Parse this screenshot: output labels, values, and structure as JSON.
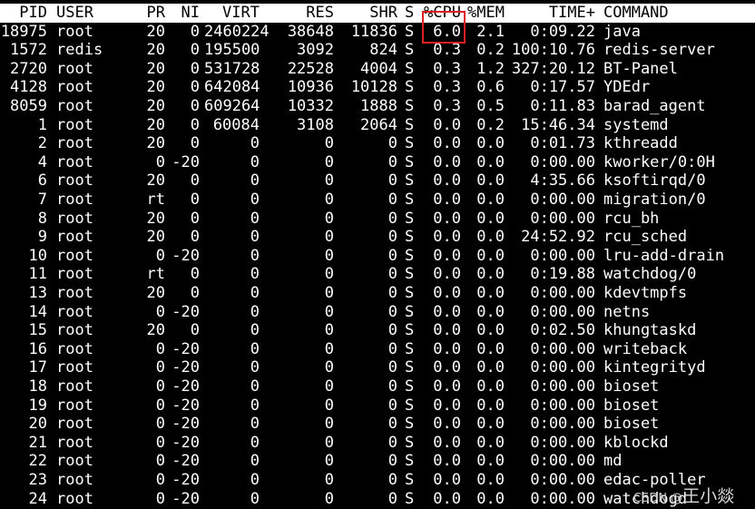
{
  "columns": {
    "pid": "PID",
    "user": "USER",
    "pr": "PR",
    "ni": "NI",
    "virt": "VIRT",
    "res": "RES",
    "shr": "SHR",
    "s": "S",
    "cpu": "%CPU",
    "mem": "%MEM",
    "time": "TIME+",
    "command": "COMMAND"
  },
  "processes": [
    {
      "pid": "18975",
      "user": "root",
      "pr": "20",
      "ni": "0",
      "virt": "2460224",
      "res": "38648",
      "shr": "11836",
      "s": "S",
      "cpu": "6.0",
      "mem": "2.1",
      "time": "0:09.22",
      "command": "java"
    },
    {
      "pid": "1572",
      "user": "redis",
      "pr": "20",
      "ni": "0",
      "virt": "195500",
      "res": "3092",
      "shr": "824",
      "s": "S",
      "cpu": "0.3",
      "mem": "0.2",
      "time": "100:10.76",
      "command": "redis-server"
    },
    {
      "pid": "2720",
      "user": "root",
      "pr": "20",
      "ni": "0",
      "virt": "531728",
      "res": "22528",
      "shr": "4004",
      "s": "S",
      "cpu": "0.3",
      "mem": "1.2",
      "time": "327:20.12",
      "command": "BT-Panel"
    },
    {
      "pid": "4128",
      "user": "root",
      "pr": "20",
      "ni": "0",
      "virt": "642084",
      "res": "10936",
      "shr": "10128",
      "s": "S",
      "cpu": "0.3",
      "mem": "0.6",
      "time": "0:17.57",
      "command": "YDEdr"
    },
    {
      "pid": "8059",
      "user": "root",
      "pr": "20",
      "ni": "0",
      "virt": "609264",
      "res": "10332",
      "shr": "1888",
      "s": "S",
      "cpu": "0.3",
      "mem": "0.5",
      "time": "0:11.83",
      "command": "barad_agent"
    },
    {
      "pid": "1",
      "user": "root",
      "pr": "20",
      "ni": "0",
      "virt": "60084",
      "res": "3108",
      "shr": "2064",
      "s": "S",
      "cpu": "0.0",
      "mem": "0.2",
      "time": "15:46.34",
      "command": "systemd"
    },
    {
      "pid": "2",
      "user": "root",
      "pr": "20",
      "ni": "0",
      "virt": "0",
      "res": "0",
      "shr": "0",
      "s": "S",
      "cpu": "0.0",
      "mem": "0.0",
      "time": "0:01.73",
      "command": "kthreadd"
    },
    {
      "pid": "4",
      "user": "root",
      "pr": "0",
      "ni": "-20",
      "virt": "0",
      "res": "0",
      "shr": "0",
      "s": "S",
      "cpu": "0.0",
      "mem": "0.0",
      "time": "0:00.00",
      "command": "kworker/0:0H"
    },
    {
      "pid": "6",
      "user": "root",
      "pr": "20",
      "ni": "0",
      "virt": "0",
      "res": "0",
      "shr": "0",
      "s": "S",
      "cpu": "0.0",
      "mem": "0.0",
      "time": "4:35.66",
      "command": "ksoftirqd/0"
    },
    {
      "pid": "7",
      "user": "root",
      "pr": "rt",
      "ni": "0",
      "virt": "0",
      "res": "0",
      "shr": "0",
      "s": "S",
      "cpu": "0.0",
      "mem": "0.0",
      "time": "0:00.00",
      "command": "migration/0"
    },
    {
      "pid": "8",
      "user": "root",
      "pr": "20",
      "ni": "0",
      "virt": "0",
      "res": "0",
      "shr": "0",
      "s": "S",
      "cpu": "0.0",
      "mem": "0.0",
      "time": "0:00.00",
      "command": "rcu_bh"
    },
    {
      "pid": "9",
      "user": "root",
      "pr": "20",
      "ni": "0",
      "virt": "0",
      "res": "0",
      "shr": "0",
      "s": "S",
      "cpu": "0.0",
      "mem": "0.0",
      "time": "24:52.92",
      "command": "rcu_sched"
    },
    {
      "pid": "10",
      "user": "root",
      "pr": "0",
      "ni": "-20",
      "virt": "0",
      "res": "0",
      "shr": "0",
      "s": "S",
      "cpu": "0.0",
      "mem": "0.0",
      "time": "0:00.00",
      "command": "lru-add-drain"
    },
    {
      "pid": "11",
      "user": "root",
      "pr": "rt",
      "ni": "0",
      "virt": "0",
      "res": "0",
      "shr": "0",
      "s": "S",
      "cpu": "0.0",
      "mem": "0.0",
      "time": "0:19.88",
      "command": "watchdog/0"
    },
    {
      "pid": "13",
      "user": "root",
      "pr": "20",
      "ni": "0",
      "virt": "0",
      "res": "0",
      "shr": "0",
      "s": "S",
      "cpu": "0.0",
      "mem": "0.0",
      "time": "0:00.00",
      "command": "kdevtmpfs"
    },
    {
      "pid": "14",
      "user": "root",
      "pr": "0",
      "ni": "-20",
      "virt": "0",
      "res": "0",
      "shr": "0",
      "s": "S",
      "cpu": "0.0",
      "mem": "0.0",
      "time": "0:00.00",
      "command": "netns"
    },
    {
      "pid": "15",
      "user": "root",
      "pr": "20",
      "ni": "0",
      "virt": "0",
      "res": "0",
      "shr": "0",
      "s": "S",
      "cpu": "0.0",
      "mem": "0.0",
      "time": "0:02.50",
      "command": "khungtaskd"
    },
    {
      "pid": "16",
      "user": "root",
      "pr": "0",
      "ni": "-20",
      "virt": "0",
      "res": "0",
      "shr": "0",
      "s": "S",
      "cpu": "0.0",
      "mem": "0.0",
      "time": "0:00.00",
      "command": "writeback"
    },
    {
      "pid": "17",
      "user": "root",
      "pr": "0",
      "ni": "-20",
      "virt": "0",
      "res": "0",
      "shr": "0",
      "s": "S",
      "cpu": "0.0",
      "mem": "0.0",
      "time": "0:00.00",
      "command": "kintegrityd"
    },
    {
      "pid": "18",
      "user": "root",
      "pr": "0",
      "ni": "-20",
      "virt": "0",
      "res": "0",
      "shr": "0",
      "s": "S",
      "cpu": "0.0",
      "mem": "0.0",
      "time": "0:00.00",
      "command": "bioset"
    },
    {
      "pid": "19",
      "user": "root",
      "pr": "0",
      "ni": "-20",
      "virt": "0",
      "res": "0",
      "shr": "0",
      "s": "S",
      "cpu": "0.0",
      "mem": "0.0",
      "time": "0:00.00",
      "command": "bioset"
    },
    {
      "pid": "20",
      "user": "root",
      "pr": "0",
      "ni": "-20",
      "virt": "0",
      "res": "0",
      "shr": "0",
      "s": "S",
      "cpu": "0.0",
      "mem": "0.0",
      "time": "0:00.00",
      "command": "bioset"
    },
    {
      "pid": "21",
      "user": "root",
      "pr": "0",
      "ni": "-20",
      "virt": "0",
      "res": "0",
      "shr": "0",
      "s": "S",
      "cpu": "0.0",
      "mem": "0.0",
      "time": "0:00.00",
      "command": "kblockd"
    },
    {
      "pid": "22",
      "user": "root",
      "pr": "0",
      "ni": "-20",
      "virt": "0",
      "res": "0",
      "shr": "0",
      "s": "S",
      "cpu": "0.0",
      "mem": "0.0",
      "time": "0:00.00",
      "command": "md"
    },
    {
      "pid": "23",
      "user": "root",
      "pr": "0",
      "ni": "-20",
      "virt": "0",
      "res": "0",
      "shr": "0",
      "s": "S",
      "cpu": "0.0",
      "mem": "0.0",
      "time": "0:00.00",
      "command": "edac-poller"
    },
    {
      "pid": "24",
      "user": "root",
      "pr": "0",
      "ni": "-20",
      "virt": "0",
      "res": "0",
      "shr": "0",
      "s": "S",
      "cpu": "0.0",
      "mem": "0.0",
      "time": "0:00.00",
      "command": "watchdogd"
    }
  ],
  "watermark": {
    "prefix": "CSDN @",
    "name": "王小燚"
  },
  "colors": {
    "background": "#000000",
    "text": "#ffffff",
    "header_background": "#ffffff",
    "header_text": "#000000",
    "highlight": "#e02020"
  }
}
